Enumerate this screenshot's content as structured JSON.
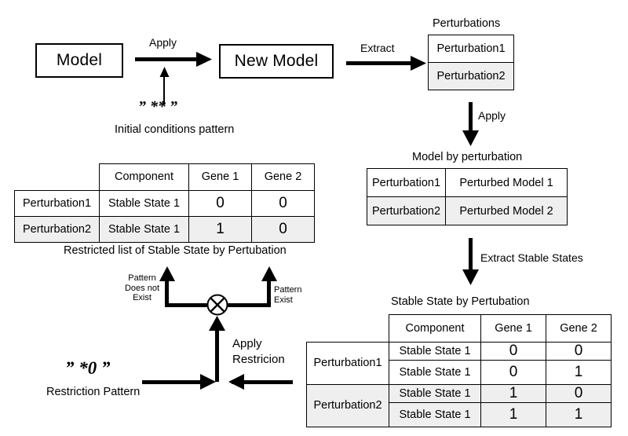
{
  "diagram": {
    "title_hidden": "",
    "boxes": {
      "model": "Model",
      "new_model": "New Model"
    },
    "arrow_labels": {
      "apply_top": "Apply",
      "extract": "Extract",
      "apply_down": "Apply",
      "extract_stable_states": "Extract Stable States",
      "apply_restriction_line1": "Apply",
      "apply_restriction_line2": "Restricion"
    },
    "patterns": {
      "initial_conditions_value": "” ** ”",
      "initial_conditions_caption": "Initial conditions pattern",
      "restriction_value": "” *0 ”",
      "restriction_caption": "Restriction Pattern"
    },
    "branch_labels": {
      "left_line1": "Pattern",
      "left_line2": "Does not",
      "left_line3": "Exist",
      "right_line1": "Pattern",
      "right_line2": "Exist"
    },
    "operator_icon": "xor-circle-icon",
    "perturbations_table": {
      "caption": "Perturbations",
      "rows": [
        {
          "label": "Perturbation1",
          "shaded": false
        },
        {
          "label": "Perturbation2",
          "shaded": true
        }
      ]
    },
    "model_by_perturbation_table": {
      "caption": "Model by  perturbation",
      "rows": [
        {
          "perturbation": "Perturbation1",
          "model": "Perturbed Model 1",
          "shaded": false
        },
        {
          "perturbation": "Perturbation2",
          "model": "Perturbed Model 2",
          "shaded": true
        }
      ]
    },
    "restricted_table": {
      "caption": "Restricted list of Stable State by Pertubation",
      "headers": {
        "corner": "",
        "component": "Component",
        "gene1": "Gene 1",
        "gene2": "Gene 2"
      },
      "rows": [
        {
          "perturbation": "Perturbation1",
          "component": "Stable State 1",
          "gene1": "0",
          "gene2": "0",
          "shaded": false
        },
        {
          "perturbation": "Perturbation2",
          "component": "Stable State 1",
          "gene1": "1",
          "gene2": "0",
          "shaded": true
        }
      ]
    },
    "stable_state_table": {
      "caption": "Stable State by Pertubation",
      "headers": {
        "corner": "",
        "component": "Component",
        "gene1": "Gene 1",
        "gene2": "Gene 2"
      },
      "groups": [
        {
          "perturbation": "Perturbation1",
          "shaded": false,
          "rows": [
            {
              "component": "Stable State 1",
              "gene1": "0",
              "gene2": "0"
            },
            {
              "component": "Stable State 1",
              "gene1": "0",
              "gene2": "1"
            }
          ]
        },
        {
          "perturbation": "Perturbation2",
          "shaded": true,
          "rows": [
            {
              "component": "Stable State 1",
              "gene1": "1",
              "gene2": "0"
            },
            {
              "component": "Stable State 1",
              "gene1": "1",
              "gene2": "1"
            }
          ]
        }
      ]
    },
    "colors": {
      "stroke": "#000000",
      "shade": "#efefef",
      "background": "#ffffff"
    }
  }
}
